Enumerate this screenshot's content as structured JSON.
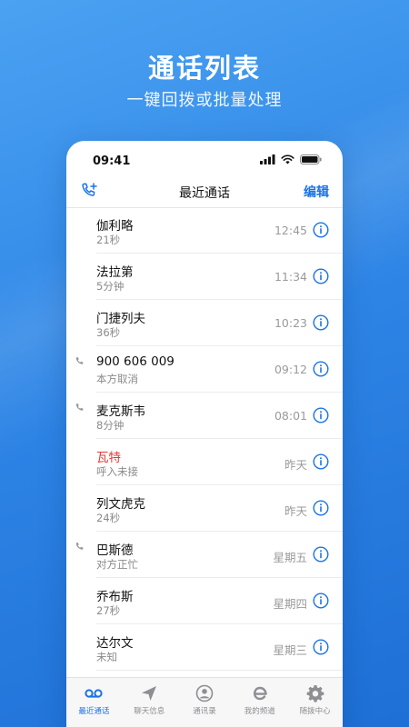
{
  "promo": {
    "title": "通话列表",
    "subtitle": "一键回拨或批量处理"
  },
  "status_bar": {
    "time": "09:41"
  },
  "navbar": {
    "title": "最近通话",
    "edit_label": "编辑",
    "add_icon": "phone-add-icon"
  },
  "colors": {
    "accent": "#1a73e8",
    "missed": "#e53935",
    "background_top": "#4ba2f2",
    "background_bottom": "#1e6fd6"
  },
  "calls": [
    {
      "name": "伽利略",
      "detail": "21秒",
      "time": "12:45",
      "outgoing": false,
      "missed": false
    },
    {
      "name": "法拉第",
      "detail": "5分钟",
      "time": "11:34",
      "outgoing": false,
      "missed": false
    },
    {
      "name": "门捷列夫",
      "detail": "36秒",
      "time": "10:23",
      "outgoing": false,
      "missed": false
    },
    {
      "name": "900 606 009",
      "detail": "本方取消",
      "time": "09:12",
      "outgoing": true,
      "missed": false
    },
    {
      "name": "麦克斯韦",
      "detail": "8分钟",
      "time": "08:01",
      "outgoing": true,
      "missed": false
    },
    {
      "name": "瓦特",
      "detail": "呼入未接",
      "time": "昨天",
      "outgoing": false,
      "missed": true
    },
    {
      "name": "列文虎克",
      "detail": "24秒",
      "time": "昨天",
      "outgoing": false,
      "missed": false
    },
    {
      "name": "巴斯德",
      "detail": "对方正忙",
      "time": "星期五",
      "outgoing": true,
      "missed": false
    },
    {
      "name": "乔布斯",
      "detail": "27秒",
      "time": "星期四",
      "outgoing": false,
      "missed": false
    },
    {
      "name": "达尔文",
      "detail": "未知",
      "time": "星期三",
      "outgoing": false,
      "missed": false
    }
  ],
  "tabs": [
    {
      "label": "最近通话",
      "icon": "voicemail-icon",
      "active": true
    },
    {
      "label": "聊天信息",
      "icon": "paper-plane-icon",
      "active": false
    },
    {
      "label": "通讯录",
      "icon": "contact-icon",
      "active": false
    },
    {
      "label": "我的频道",
      "icon": "e-channel-icon",
      "active": false
    },
    {
      "label": "随拨中心",
      "icon": "gear-icon",
      "active": false
    }
  ]
}
